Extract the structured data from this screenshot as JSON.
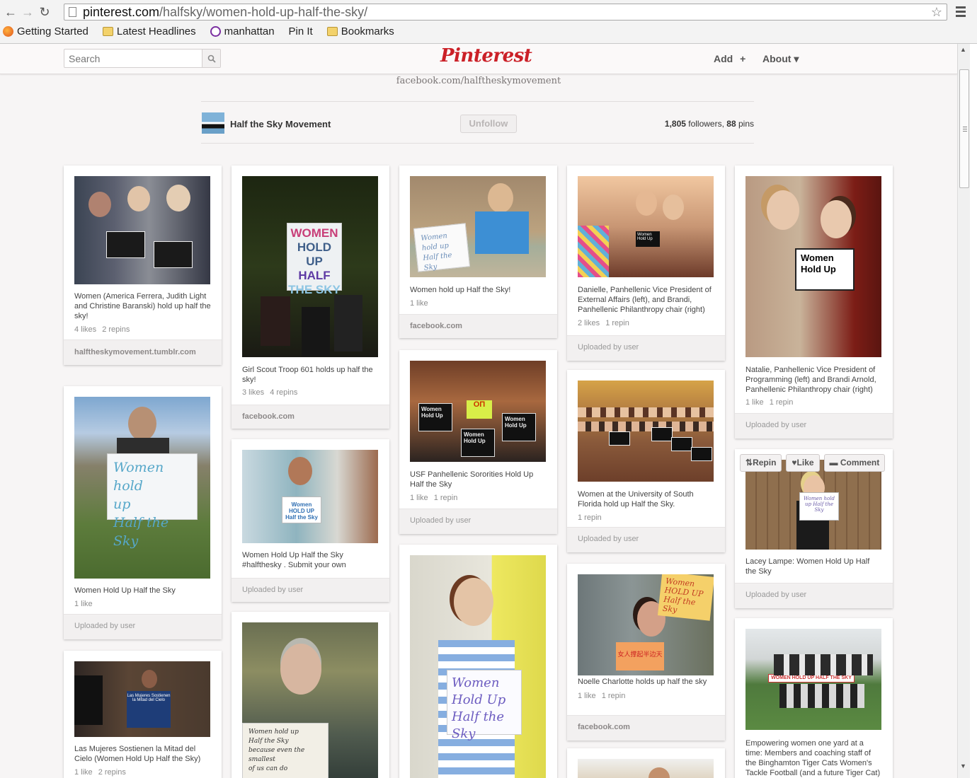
{
  "browser": {
    "url_domain": "pinterest.com",
    "url_path": "/halfsky/women-hold-up-half-the-sky/",
    "bookmarks": [
      {
        "label": "Getting Started",
        "icon": "firefox-icon"
      },
      {
        "label": "Latest Headlines",
        "icon": "folder-icon"
      },
      {
        "label": "manhattan",
        "icon": "peace-icon"
      },
      {
        "label": "Pin It",
        "icon": "page-icon"
      },
      {
        "label": "Bookmarks",
        "icon": "folder-icon"
      }
    ]
  },
  "header": {
    "search_placeholder": "Search",
    "logo": "Pinterest",
    "add_label": "Add",
    "add_symbol": "+",
    "about_label": "About",
    "about_symbol": "▾"
  },
  "board": {
    "source_link": "facebook.com/halftheskymovement",
    "owner": "Half the Sky Movement",
    "unfollow_label": "Unfollow",
    "followers_count": "1,805",
    "followers_word": " followers, ",
    "pins_count": "88",
    "pins_word": " pins"
  },
  "pins": [
    {
      "desc": "Women (America Ferrera, Judith Light and Christine Baranski) hold up half the sky!",
      "likes": "4 likes",
      "repins": "2 repins",
      "footer": "halftheskymovement.tumblr.com"
    },
    {
      "desc": "Women Hold Up Half the Sky",
      "likes": "1 like",
      "repins": "",
      "footer": "Uploaded by user"
    },
    {
      "desc": "Las Mujeres Sostienen la Mitad del Cielo (Women Hold Up Half the Sky)",
      "likes": "1 like",
      "repins": "2 repins",
      "footer": ""
    },
    {
      "desc": "Girl Scout Troop 601 holds up half the sky!",
      "likes": "3 likes",
      "repins": "4 repins",
      "footer": "facebook.com"
    },
    {
      "desc": "Women Hold Up Half the Sky #halfthesky . Submit your own",
      "likes": "",
      "repins": "",
      "footer": "Uploaded by user"
    },
    {
      "desc": "",
      "likes": "",
      "repins": "",
      "footer": ""
    },
    {
      "desc": "Women hold up Half the Sky!",
      "likes": "1 like",
      "repins": "",
      "footer": "facebook.com"
    },
    {
      "desc": "USF Panhellenic Sororities Hold Up Half the Sky",
      "likes": "1 like",
      "repins": "1 repin",
      "footer": "Uploaded by user"
    },
    {
      "desc": "",
      "likes": "",
      "repins": "",
      "footer": ""
    },
    {
      "desc": "Danielle, Panhellenic Vice President of External Affairs (left), and Brandi, Panhellenic Philanthropy chair (right)",
      "likes": "2 likes",
      "repins": "1 repin",
      "footer": "Uploaded by user"
    },
    {
      "desc": "Women at the University of South Florida hold up Half the Sky.",
      "likes": "1 repin",
      "repins": "",
      "footer": "Uploaded by user"
    },
    {
      "desc": "Noelle Charlotte holds up half the sky",
      "likes": "1 like",
      "repins": "1 repin",
      "footer": "facebook.com"
    },
    {
      "desc": "",
      "likes": "",
      "repins": "",
      "footer": ""
    },
    {
      "desc": "Natalie, Panhellenic Vice President of Programming (left) and Brandi Arnold, Panhellenic Philanthropy chair (right)",
      "likes": "1 like",
      "repins": "1 repin",
      "footer": "Uploaded by user"
    },
    {
      "desc": "Lacey Lampe: Women Hold Up Half the Sky",
      "likes": "",
      "repins": "",
      "footer": "Uploaded by user"
    },
    {
      "desc": "Empowering women one yard at a time: Members and coaching staff of the Binghamton Tiger Cats Women's Tackle Football (and a future Tiger Cat) show",
      "likes": "",
      "repins": "",
      "footer": ""
    }
  ],
  "hover_actions": {
    "repin": "Repin",
    "like": "Like",
    "comment": "Comment"
  },
  "photo_signs": {
    "girl_scout": "WOMEN HOLD UP HALF THE SKY",
    "boy": "Women hold up Half the Sky",
    "yard": "Women hold up Half the Sky",
    "brunette": "Women Hold Up Half the Sky",
    "noelle_top": "Women HOLD UP Half the Sky"
  }
}
